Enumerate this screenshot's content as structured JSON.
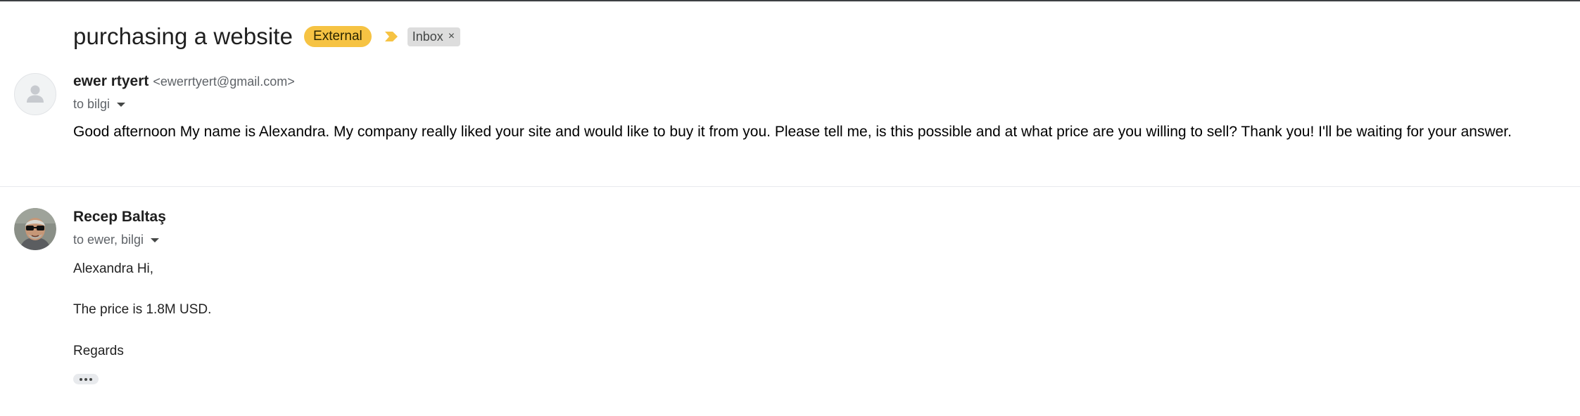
{
  "thread": {
    "subject": "purchasing a website",
    "labels": {
      "external": "External",
      "inbox": "Inbox",
      "remove_symbol": "×"
    }
  },
  "messages": [
    {
      "sender_name": "ewer rtyert",
      "sender_email": "<ewerrtyert@gmail.com>",
      "to": "to bilgi",
      "body": "Good afternoon My name is Alexandra. My company really liked your site and would like to buy it from you. Please tell me, is this possible and at what price are you willing to sell? Thank you! I'll be waiting for your answer."
    },
    {
      "sender_name": "Recep Baltaş",
      "to": "to ewer, bilgi",
      "body_lines": [
        "Alexandra Hi,",
        "The price is 1.8M USD.",
        "Regards"
      ]
    }
  ],
  "colors": {
    "external_label": "#f6c343",
    "importance_marker": "#f6c343",
    "inbox_label": "#dddddd"
  },
  "icons": {
    "importance": "importance-marker-icon",
    "default_avatar": "person-icon",
    "dropdown": "caret-down-icon",
    "more": "ellipsis-icon"
  }
}
